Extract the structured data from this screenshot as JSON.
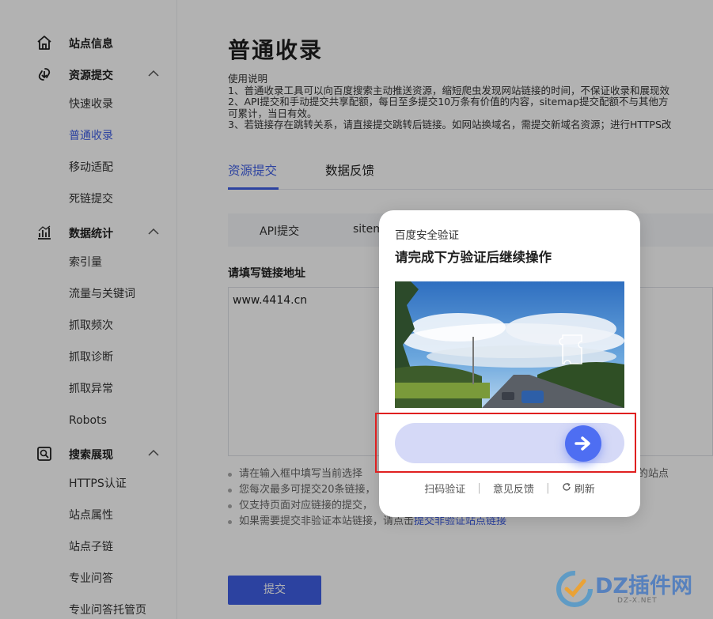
{
  "sidebar": {
    "groups": [
      {
        "label": "站点信息",
        "icon": "home-icon"
      },
      {
        "label": "资源提交",
        "icon": "resource-submit-icon",
        "items": [
          "快速收录",
          "普通收录",
          "移动适配",
          "死链提交"
        ]
      },
      {
        "label": "数据统计",
        "icon": "bar-chart-icon",
        "items": [
          "索引量",
          "流量与关键词",
          "抓取频次",
          "抓取诊断",
          "抓取异常",
          "Robots"
        ]
      },
      {
        "label": "搜索展现",
        "icon": "search-display-icon",
        "items": [
          "HTTPS认证",
          "站点属性",
          "站点子链",
          "专业问答",
          "专业问答托管页"
        ]
      }
    ],
    "active_item": "普通收录"
  },
  "main": {
    "title": "普通收录",
    "notes": [
      "使用说明",
      "1、普通收录工具可以向百度搜索主动推送资源，缩短爬虫发现网站链接的时间，不保证收录和展现效",
      "2、API提交和手动提交共享配额，每日至多提交10万条有价值的内容，sitemap提交配额不与其他方",
      "可累计，当日有效。",
      "3、若链接存在跳转关系，请直接提交跳转后链接。如网站换域名，需提交新域名资源；进行HTTPS改"
    ],
    "tabs": [
      "资源提交",
      "数据反馈"
    ],
    "subtabs": [
      "API提交",
      "sitem"
    ],
    "field_label": "请填写链接地址",
    "url_value": "www.4414.cn",
    "tips": [
      "请在输入框中填写当前选择",
      "您每次最多可提交20条链接，",
      "仅支持页面对应链接的提交，",
      "如果需要提交非验证本站链接，请点击"
    ],
    "tip_link": "提交非验证站点链接",
    "tip_right": "的站点",
    "submit_label": "提交"
  },
  "captcha": {
    "brand": "百度安全验证",
    "title": "请完成下方验证后继续操作",
    "links": {
      "scan": "扫码验证",
      "feedback": "意见反馈",
      "refresh": "刷新"
    }
  },
  "watermark": {
    "text": "DZ插件网",
    "sub": "DZ-X.NET"
  },
  "colors": {
    "accent": "#3f5fe6",
    "slider": "#4e6ef2",
    "highlight": "#e02020"
  }
}
